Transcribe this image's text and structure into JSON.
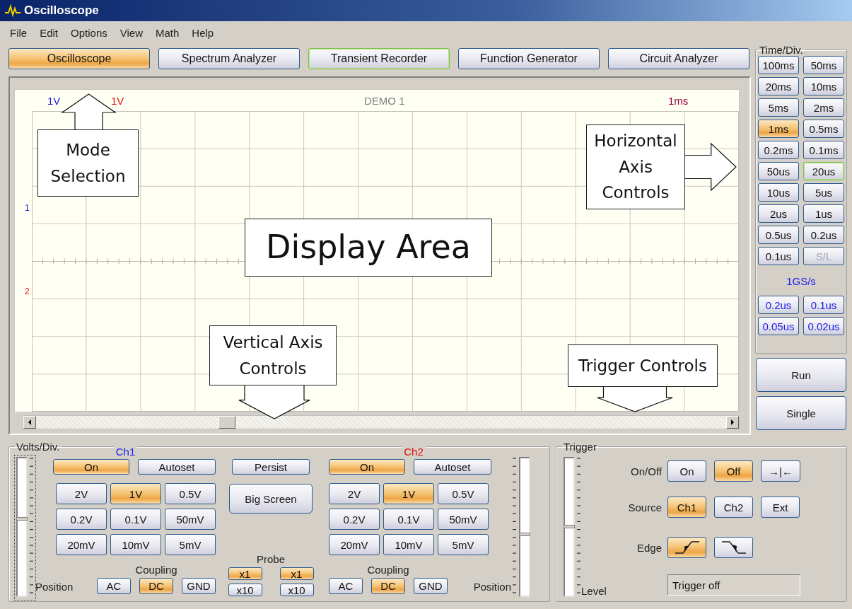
{
  "window": {
    "title": "Oscilloscope"
  },
  "menu": [
    "File",
    "Edit",
    "Options",
    "View",
    "Math",
    "Help"
  ],
  "modes": [
    {
      "label": "Oscilloscope",
      "selected": true,
      "focused": false
    },
    {
      "label": "Spectrum Analyzer",
      "selected": false,
      "focused": false
    },
    {
      "label": "Transient Recorder",
      "selected": false,
      "focused": true
    },
    {
      "label": "Function Generator",
      "selected": false,
      "focused": false
    },
    {
      "label": "Circuit Analyzer",
      "selected": false,
      "focused": false
    }
  ],
  "display": {
    "ch1_scale": "1V",
    "ch2_scale": "1V",
    "title": "DEMO 1",
    "time_scale": "1ms",
    "ch1_marker": "1",
    "ch2_marker": "2"
  },
  "annotations": [
    {
      "text": "Mode Selection",
      "kind": "up"
    },
    {
      "text": "Horizontal Axis Controls",
      "kind": "right"
    },
    {
      "text": "Display Area",
      "kind": "plain"
    },
    {
      "text": "Vertical Axis Controls",
      "kind": "down"
    },
    {
      "text": "Trigger Controls",
      "kind": "down"
    }
  ],
  "time_div": {
    "label": "Time/Div.",
    "buttons": [
      {
        "label": "100ms",
        "selected": false,
        "focused": false,
        "disabled": false
      },
      {
        "label": "50ms",
        "selected": false,
        "focused": false,
        "disabled": false
      },
      {
        "label": "20ms",
        "selected": false,
        "focused": false,
        "disabled": false
      },
      {
        "label": "10ms",
        "selected": false,
        "focused": false,
        "disabled": false
      },
      {
        "label": "5ms",
        "selected": false,
        "focused": false,
        "disabled": false
      },
      {
        "label": "2ms",
        "selected": false,
        "focused": false,
        "disabled": false
      },
      {
        "label": "1ms",
        "selected": true,
        "focused": false,
        "disabled": false
      },
      {
        "label": "0.5ms",
        "selected": false,
        "focused": false,
        "disabled": false
      },
      {
        "label": "0.2ms",
        "selected": false,
        "focused": false,
        "disabled": false
      },
      {
        "label": "0.1ms",
        "selected": false,
        "focused": false,
        "disabled": false
      },
      {
        "label": "50us",
        "selected": false,
        "focused": false,
        "disabled": false
      },
      {
        "label": "20us",
        "selected": false,
        "focused": true,
        "disabled": false
      },
      {
        "label": "10us",
        "selected": false,
        "focused": false,
        "disabled": false
      },
      {
        "label": "5us",
        "selected": false,
        "focused": false,
        "disabled": false
      },
      {
        "label": "2us",
        "selected": false,
        "focused": false,
        "disabled": false
      },
      {
        "label": "1us",
        "selected": false,
        "focused": false,
        "disabled": false
      },
      {
        "label": "0.5us",
        "selected": false,
        "focused": false,
        "disabled": false
      },
      {
        "label": "0.2us",
        "selected": false,
        "focused": false,
        "disabled": false
      },
      {
        "label": "0.1us",
        "selected": false,
        "focused": false,
        "disabled": false
      },
      {
        "label": "S/L",
        "selected": false,
        "focused": false,
        "disabled": true
      }
    ],
    "rate": "1GS/s",
    "fast_buttons": [
      {
        "label": "0.2us",
        "selected": false
      },
      {
        "label": "0.1us",
        "selected": false
      },
      {
        "label": "0.05us",
        "selected": false
      },
      {
        "label": "0.02us",
        "selected": false
      }
    ]
  },
  "run": "Run",
  "single": "Single",
  "vertical": {
    "label": "Volts/Div.",
    "persist": "Persist",
    "big_screen": "Big Screen",
    "probe": {
      "label": "Probe",
      "ch1": [
        {
          "label": "x1",
          "selected": true
        },
        {
          "label": "x10",
          "selected": false
        }
      ],
      "ch2": [
        {
          "label": "x1",
          "selected": true
        },
        {
          "label": "x10",
          "selected": false
        }
      ]
    },
    "channels": [
      {
        "name": "Ch1",
        "color": "#2020f0",
        "on": {
          "label": "On",
          "selected": true
        },
        "autoset": "Autoset",
        "volts": [
          {
            "label": "2V",
            "selected": false
          },
          {
            "label": "1V",
            "selected": true
          },
          {
            "label": "0.5V",
            "selected": false
          },
          {
            "label": "0.2V",
            "selected": false
          },
          {
            "label": "0.1V",
            "selected": false
          },
          {
            "label": "50mV",
            "selected": false
          },
          {
            "label": "20mV",
            "selected": false
          },
          {
            "label": "10mV",
            "selected": false
          },
          {
            "label": "5mV",
            "selected": false
          }
        ],
        "coupling_label": "Coupling",
        "coupling": [
          {
            "label": "AC",
            "selected": false
          },
          {
            "label": "DC",
            "selected": true
          },
          {
            "label": "GND",
            "selected": false
          }
        ],
        "position_label": "Position",
        "position": {
          "level": 0.56
        }
      },
      {
        "name": "Ch2",
        "color": "#e01010",
        "on": {
          "label": "On",
          "selected": true
        },
        "autoset": "Autoset",
        "volts": [
          {
            "label": "2V",
            "selected": false
          },
          {
            "label": "1V",
            "selected": true
          },
          {
            "label": "0.5V",
            "selected": false
          },
          {
            "label": "0.2V",
            "selected": false
          },
          {
            "label": "0.1V",
            "selected": false
          },
          {
            "label": "50mV",
            "selected": false
          },
          {
            "label": "20mV",
            "selected": false
          },
          {
            "label": "10mV",
            "selected": false
          },
          {
            "label": "5mV",
            "selected": false
          }
        ],
        "coupling_label": "Coupling",
        "coupling": [
          {
            "label": "AC",
            "selected": false
          },
          {
            "label": "DC",
            "selected": true
          },
          {
            "label": "GND",
            "selected": false
          }
        ],
        "position_label": "Position",
        "position": {
          "level": 0.44
        }
      }
    ]
  },
  "trigger": {
    "label": "Trigger",
    "level": 0.5,
    "level_label": "Level",
    "onoff_label": "On/Off",
    "onoff": [
      {
        "label": "On",
        "selected": false
      },
      {
        "label": "Off",
        "selected": true
      },
      {
        "label": "→|←",
        "selected": false
      }
    ],
    "source_label": "Source",
    "source": [
      {
        "label": "Ch1",
        "selected": true
      },
      {
        "label": "Ch2",
        "selected": false
      },
      {
        "label": "Ext",
        "selected": false
      }
    ],
    "edge_label": "Edge",
    "edge": [
      {
        "kind": "rising",
        "selected": true
      },
      {
        "kind": "falling",
        "selected": false
      }
    ],
    "status": "Trigger off"
  }
}
